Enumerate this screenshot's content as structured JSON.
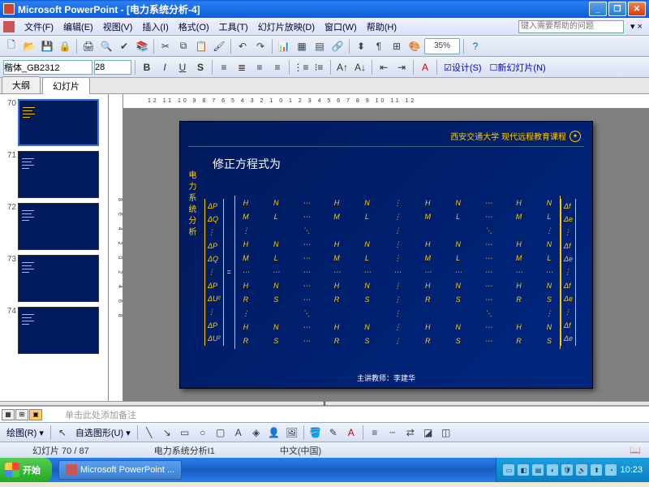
{
  "window": {
    "title": "Microsoft PowerPoint - [电力系统分析-4]"
  },
  "menu": {
    "items": [
      "文件(F)",
      "编辑(E)",
      "视图(V)",
      "插入(I)",
      "格式(O)",
      "工具(T)",
      "幻灯片放映(D)",
      "窗口(W)",
      "帮助(H)"
    ],
    "askhelp": "键入需要帮助的问题"
  },
  "format": {
    "font": "楷体_GB2312",
    "size": "28",
    "design_label": "设计(S)",
    "newslide_label": "新幻灯片(N)"
  },
  "tabs": {
    "outline": "大纲",
    "slides": "幻灯片"
  },
  "zoom": "35%",
  "thumbs": [
    "70",
    "71",
    "72",
    "73",
    "74"
  ],
  "ruler_marks": "12 11 10 9 8 7 6 5 4 3 2 1 0 1 2 3 4 5 6 7 8 9 10 11 12",
  "slide": {
    "org": "西安交通大学 现代远程教育课程",
    "sidetext": "电力系统分析",
    "heading": "修正方程式为",
    "lhs": [
      "ΔP",
      "ΔQ",
      "⋮",
      "ΔP",
      "ΔQ",
      "⋮",
      "ΔP",
      "ΔU²",
      "⋮",
      "ΔP",
      "ΔU²"
    ],
    "rhs": [
      "Δf",
      "Δe",
      "⋮",
      "Δf",
      "Δe",
      "⋮",
      "Δf",
      "Δe",
      "⋮",
      "Δf",
      "Δe"
    ],
    "matrix_rows": [
      [
        "H",
        "N",
        "⋯",
        "H",
        "N",
        "⋮",
        "H",
        "N",
        "⋯",
        "H",
        "N"
      ],
      [
        "M",
        "L",
        "⋯",
        "M",
        "L",
        "⋮",
        "M",
        "L",
        "⋯",
        "M",
        "L"
      ],
      [
        "⋮",
        "",
        "⋱",
        "",
        "",
        "⋮",
        "",
        "",
        "⋱",
        "",
        "⋮"
      ],
      [
        "H",
        "N",
        "⋯",
        "H",
        "N",
        "⋮",
        "H",
        "N",
        "⋯",
        "H",
        "N"
      ],
      [
        "M",
        "L",
        "⋯",
        "M",
        "L",
        "⋮",
        "M",
        "L",
        "⋯",
        "M",
        "L"
      ],
      [
        "⋯",
        "⋯",
        "⋯",
        "⋯",
        "⋯",
        "⋯",
        "⋯",
        "⋯",
        "⋯",
        "⋯",
        "⋯"
      ],
      [
        "H",
        "N",
        "⋯",
        "H",
        "N",
        "⋮",
        "H",
        "N",
        "⋯",
        "H",
        "N"
      ],
      [
        "R",
        "S",
        "⋯",
        "R",
        "S",
        "⋮",
        "R",
        "S",
        "⋯",
        "R",
        "S"
      ],
      [
        "⋮",
        "",
        "⋱",
        "",
        "",
        "⋮",
        "",
        "",
        "⋱",
        "",
        "⋮"
      ],
      [
        "H",
        "N",
        "⋯",
        "H",
        "N",
        "⋮",
        "H",
        "N",
        "⋯",
        "H",
        "N"
      ],
      [
        "R",
        "S",
        "⋯",
        "R",
        "S",
        "⋮",
        "R",
        "S",
        "⋯",
        "R",
        "S"
      ]
    ],
    "footer_label": "主讲教师：",
    "footer_name": "李建华"
  },
  "notes": {
    "placeholder": "单击此处添加备注"
  },
  "draw": {
    "label": "绘图(R)",
    "autoshape": "自选图形(U)"
  },
  "status": {
    "slide": "幻灯片 70 / 87",
    "design": "电力系统分析I1",
    "lang": "中文(中国)"
  },
  "taskbar": {
    "start": "开始",
    "app": "Microsoft PowerPoint ...",
    "time": "10:23"
  }
}
